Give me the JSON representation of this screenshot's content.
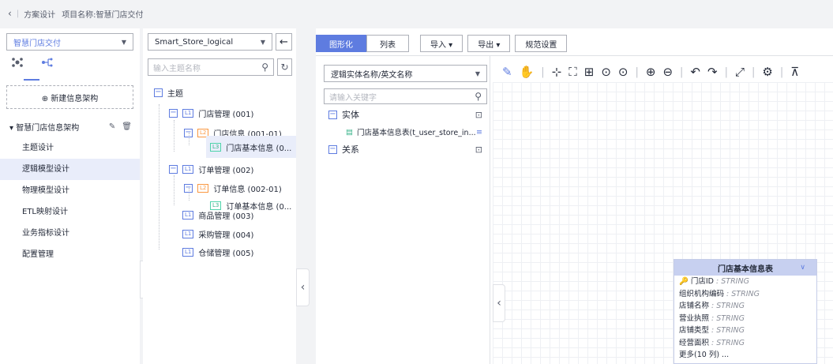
{
  "breadcrumb": {
    "back_icon": "chevron-left-icon",
    "section": "方案设计",
    "project": "项目名称:智慧门店交付"
  },
  "sidebar": {
    "project_select": "智慧门店交付",
    "new_button": "⊕ 新建信息架构",
    "architecture": "▾ 智慧门店信息架构",
    "items": [
      {
        "label": "主题设计"
      },
      {
        "label": "逻辑模型设计",
        "active": true
      },
      {
        "label": "物理模型设计"
      },
      {
        "label": "ETL映射设计"
      },
      {
        "label": "业务指标设计"
      },
      {
        "label": "配置管理"
      }
    ]
  },
  "subject_panel": {
    "model_select": "Smart_Store_logical",
    "search_placeholder": "输入主题名称",
    "root": "主题",
    "nodes": [
      {
        "level": "L1",
        "label": "门店管理 (001)"
      },
      {
        "level": "L2",
        "label": "门店信息 (001-01)"
      },
      {
        "level": "L3",
        "label": "门店基本信息 (0..."
      },
      {
        "level": "L1",
        "label": "订单管理 (002)"
      },
      {
        "level": "L2",
        "label": "订单信息 (002-01)"
      },
      {
        "level": "L3",
        "label": "订单基本信息 (0..."
      },
      {
        "level": "L1",
        "label": "商品管理 (003)"
      },
      {
        "level": "L1",
        "label": "采购管理 (004)"
      },
      {
        "level": "L1",
        "label": "仓储管理 (005)"
      }
    ]
  },
  "main": {
    "tabs": [
      "图形化",
      "列表"
    ],
    "actions": [
      "导入 ▾",
      "导出 ▾",
      "规范设置"
    ],
    "entity_select": "逻辑实体名称/英文名称",
    "keyword_placeholder": "请输入关键字",
    "entity_group": "实体",
    "entity_item": "门店基本信息表(t_user_store_in...",
    "relation_group": "关系"
  },
  "er_entity": {
    "title": "门店基本信息表",
    "fields": [
      {
        "name": "门店ID",
        "type": " : STRING",
        "key": true
      },
      {
        "name": "组织机构编码",
        "type": " : STRING"
      },
      {
        "name": "店铺名称",
        "type": " : STRING"
      },
      {
        "name": "营业执照",
        "type": " : STRING"
      },
      {
        "name": "店铺类型",
        "type": " : STRING"
      },
      {
        "name": "经营面积",
        "type": " : STRING"
      }
    ],
    "more": "更多(10 列) ..."
  },
  "colors": {
    "accent": "#5e7ce0",
    "l2": "#fa9841",
    "l3": "#50d4ab",
    "key": "#fa9841"
  }
}
